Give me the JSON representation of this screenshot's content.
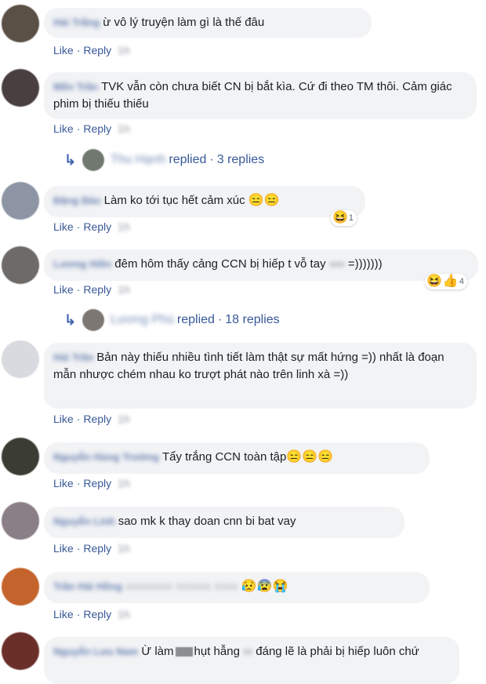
{
  "actions": {
    "like": "Like",
    "reply": "Reply",
    "sep": "·"
  },
  "comments": [
    {
      "name": "Hải Trắng",
      "text": "ừ vô lý truyện làm gì là thế đâu",
      "time": "1h",
      "avatar_color": "#5b5046"
    },
    {
      "name": "Mến Trần",
      "text": "TVK vẫn còn chưa biết CN bị bắt kìa. Cứ đi theo TM thôi. Cảm giác phim bị thiếu thiếu",
      "time": "1h",
      "avatar_color": "#4a3f40",
      "replies": {
        "name": "Thu Hạnh",
        "text": "replied",
        "count": "3 replies"
      }
    },
    {
      "name": "Đặng Bảo",
      "text": "Làm ko tới tục hết cảm xúc",
      "time": "1h",
      "avatar_color": "#8d95a4",
      "reactions": {
        "count": "1"
      }
    },
    {
      "name": "Lương Hiền",
      "text": "đêm hôm thấy cảng CCN bị hiếp t vỗ tay",
      "text2": "=)))))))",
      "time": "1h",
      "avatar_color": "#6d6a68",
      "reactions": {
        "count": "4"
      },
      "replies": {
        "name": "Lương Phú",
        "text": "replied",
        "count": "18 replies"
      }
    },
    {
      "name": "Hải Trần",
      "text": "Bản này thiếu nhiều tình tiết làm thật sự mất hứng =)) nhất là đoạn mẫn nhược chém nhau ko trượt phát nào trên linh xà =))",
      "time": "1h",
      "avatar_color": "#d8dadf"
    },
    {
      "name": "Nguyễn Hùng Trường",
      "text": "Tẩy trắng CCN toàn tập",
      "time": "1h",
      "avatar_color": "#3b3c34"
    },
    {
      "name": "Nguyễn Linh",
      "text": "sao mk k thay doan cnn bi bat vay",
      "time": "1h",
      "avatar_color": "#8a7f86"
    },
    {
      "name": "Trần Hải Hồng",
      "text": "",
      "time": "1h",
      "avatar_color": "#c4632b"
    },
    {
      "name": "Nguyễn Lưu Nam",
      "text": "Ừ làm",
      "text_mid": "hụt hẫng",
      "text2": "đáng lẽ là phải bị hiếp luôn chứ",
      "time": "1h",
      "avatar_color": "#6b2f2a"
    }
  ]
}
